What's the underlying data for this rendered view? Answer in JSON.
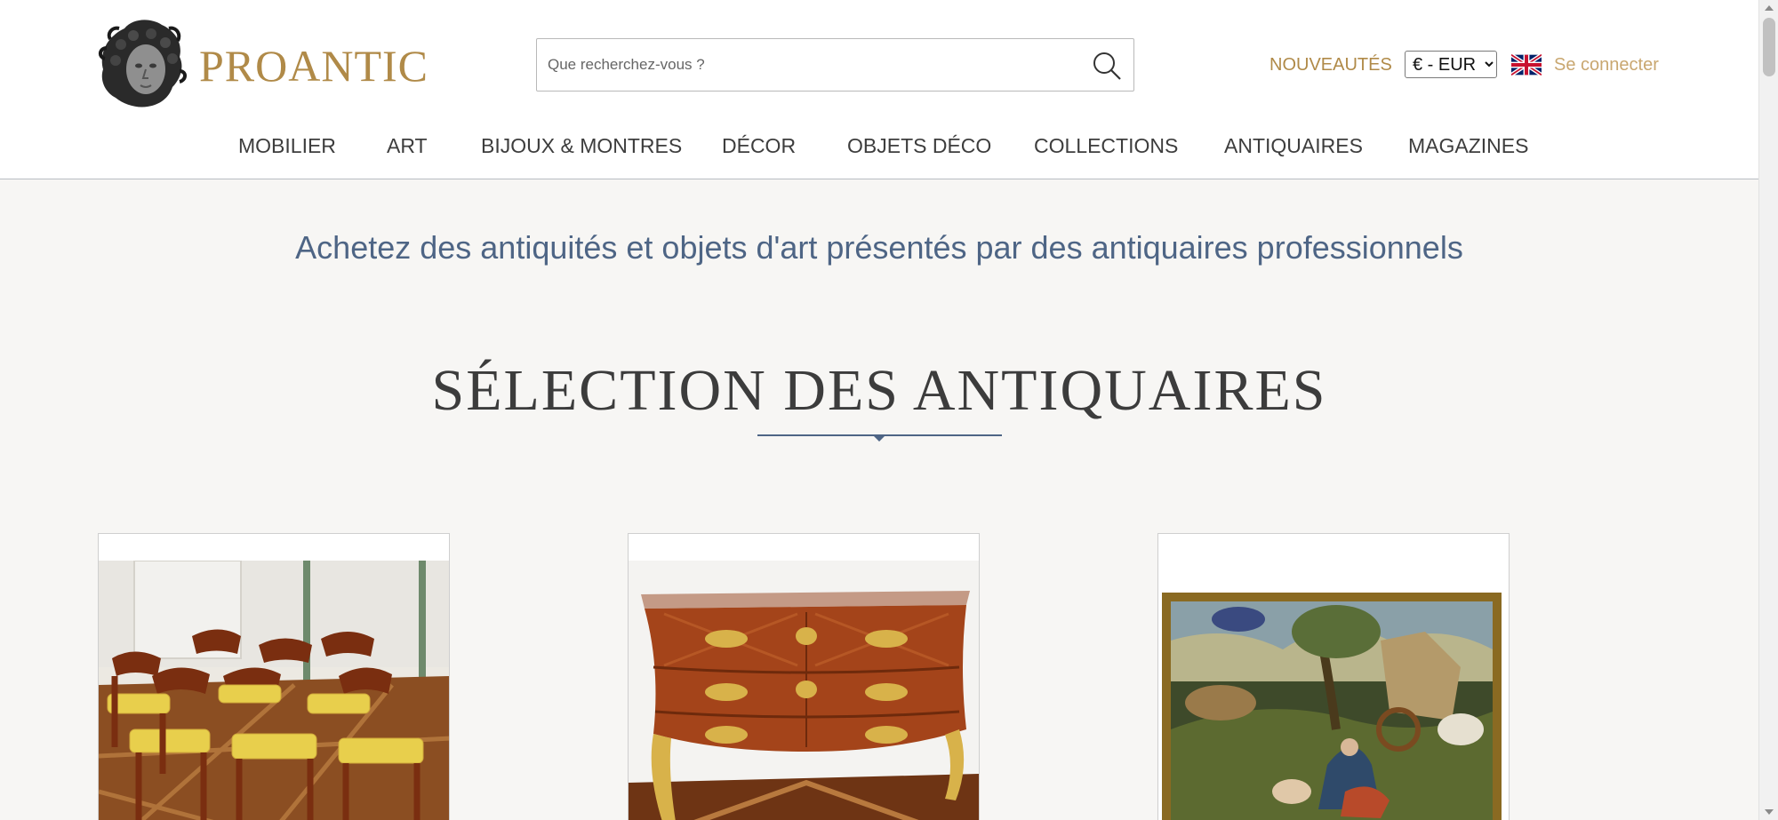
{
  "header": {
    "logo_text": "PROANTIC",
    "search": {
      "placeholder": "Que recherchez-vous ?"
    },
    "nouveautes_label": "NOUVEAUTÉS",
    "currency": {
      "selected": "€ - EUR"
    },
    "login_label": "Se connecter"
  },
  "nav": {
    "items": [
      {
        "label": "MOBILIER"
      },
      {
        "label": "ART"
      },
      {
        "label": "BIJOUX & MONTRES"
      },
      {
        "label": "DÉCOR"
      },
      {
        "label": "OBJETS DÉCO"
      },
      {
        "label": "COLLECTIONS"
      },
      {
        "label": "ANTIQUAIRES"
      },
      {
        "label": "MAGAZINES"
      }
    ]
  },
  "main": {
    "tagline": "Achetez des antiquités et objets d'art présentés par des antiquaires professionnels",
    "section_title": "SÉLECTION DES ANTIQUAIRES",
    "cards": [
      {
        "image": "empire-chairs-set-photo"
      },
      {
        "image": "louis-xv-commode-photo"
      },
      {
        "image": "framed-painting-photo"
      }
    ]
  },
  "colors": {
    "brand_gold": "#b08a48",
    "accent_blue": "#4e6585",
    "page_background": "#f7f6f4"
  }
}
